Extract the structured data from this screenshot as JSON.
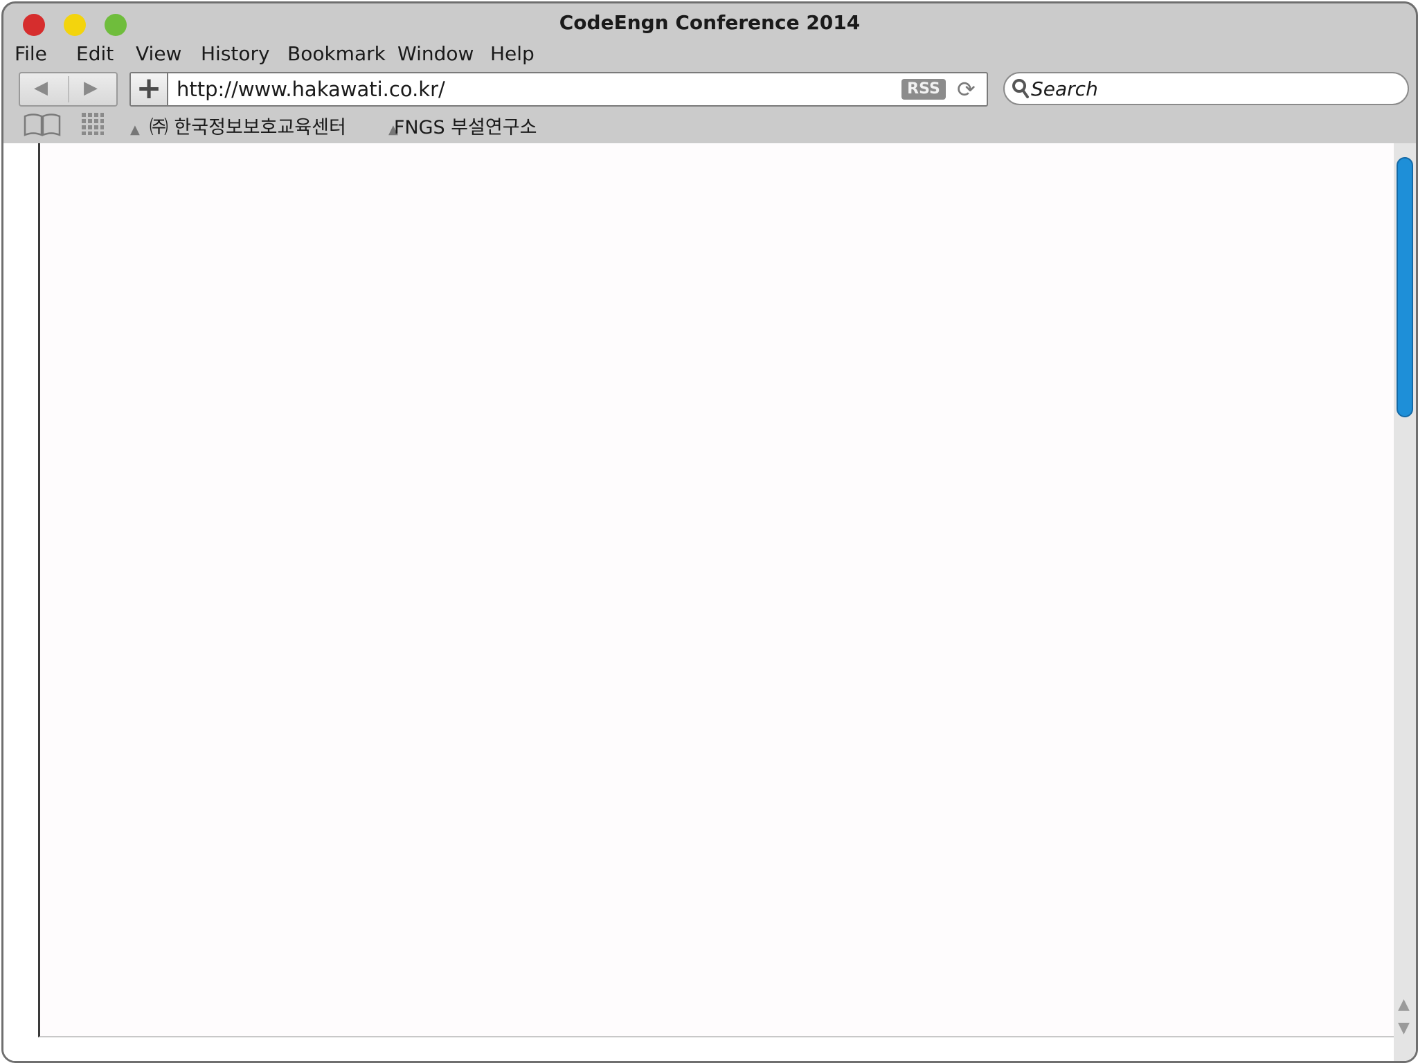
{
  "window": {
    "title": "CodeEngn Conference 2014"
  },
  "menu": {
    "items": [
      {
        "label": "File"
      },
      {
        "label": "Edit"
      },
      {
        "label": "View"
      },
      {
        "label": "History"
      },
      {
        "label": "Bookmark"
      },
      {
        "label": "Window"
      },
      {
        "label": "Help"
      }
    ]
  },
  "toolbar": {
    "back": "◀",
    "forward": "▶",
    "add": "+",
    "url": "http://www.hakawati.co.kr/",
    "rss": "RSS",
    "reload": "⟳",
    "search_placeholder": "Search"
  },
  "bookmarks": {
    "items": [
      {
        "label": "㈜ 한국정보보호교육센터"
      },
      {
        "label": "FNGS 부설연구소"
      }
    ]
  },
  "colors": {
    "chrome": "#cbcbcb",
    "close": "#d62d2d",
    "minimize": "#f3d40d",
    "maximize": "#6fbd3c",
    "scroll_thumb": "#1e8fd8"
  },
  "icons": {
    "reading_list": "book-open-icon",
    "top_sites": "grid-icon",
    "search": "magnifier-icon"
  }
}
